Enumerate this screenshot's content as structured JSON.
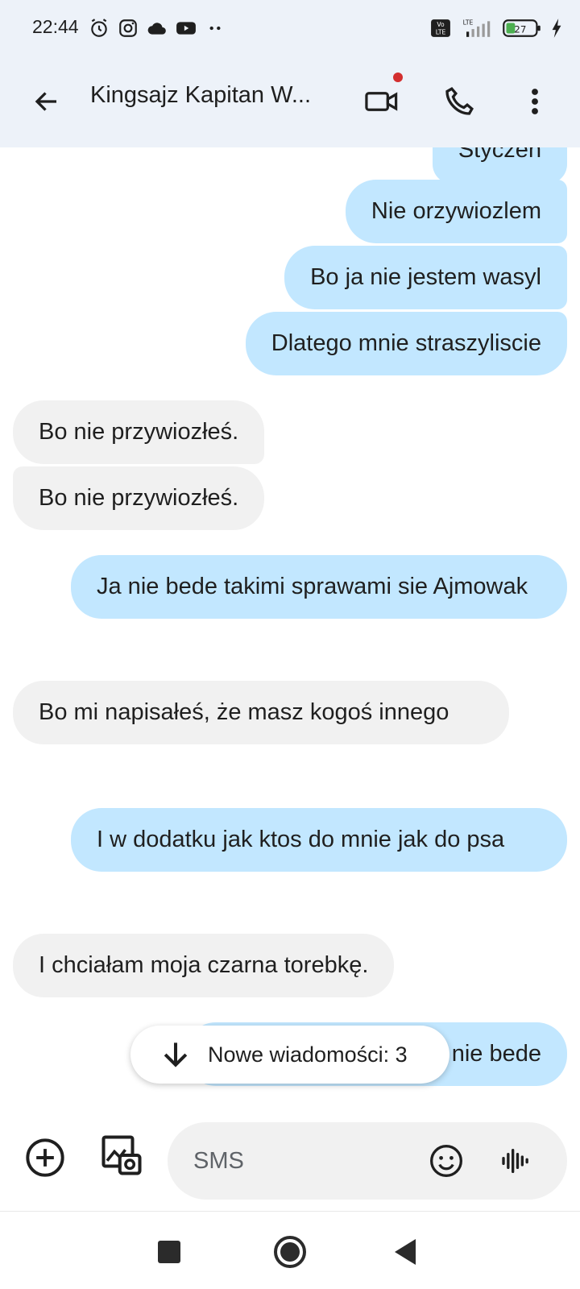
{
  "status_bar": {
    "time": "22:44",
    "battery": "27",
    "left_icons": [
      "alarm-icon",
      "instagram-icon",
      "cloud-icon",
      "youtube-icon",
      "more-dots-icon"
    ],
    "right_icons": [
      "volte-icon",
      "signal-icon",
      "battery-icon",
      "charging-icon"
    ]
  },
  "header": {
    "contact_name": "Kingsajz Kapitan W..."
  },
  "messages": [
    {
      "direction": "outgoing",
      "text": "Styczeń"
    },
    {
      "direction": "outgoing",
      "text": "Nie orzywiozlem"
    },
    {
      "direction": "outgoing",
      "text": "Bo ja nie jestem wasyl"
    },
    {
      "direction": "outgoing",
      "text": "Dlatego mnie straszyliscie"
    },
    {
      "direction": "incoming",
      "text": "Bo nie przywiozłeś."
    },
    {
      "direction": "incoming",
      "text": "Bo nie przywiozłeś."
    },
    {
      "direction": "outgoing",
      "text": "Ja nie bede takimi sprawami sie Ajmowak"
    },
    {
      "direction": "incoming",
      "text": "Bo mi napisałeś, że masz kogoś innego"
    },
    {
      "direction": "outgoing",
      "text": "I w dodatku jak ktos do mnie jak do psa"
    },
    {
      "direction": "incoming",
      "text": "I chciałam moja czarna torebkę."
    },
    {
      "direction": "outgoing",
      "text": "nie bede"
    }
  ],
  "new_messages_chip": {
    "label": "Nowe wiadomości: 3"
  },
  "composer": {
    "placeholder": "SMS"
  },
  "colors": {
    "outgoing_bubble": "#c2e7ff",
    "incoming_bubble": "#f1f1f1",
    "header_bg": "#edf2f9",
    "notification_dot": "#d32f2f"
  }
}
